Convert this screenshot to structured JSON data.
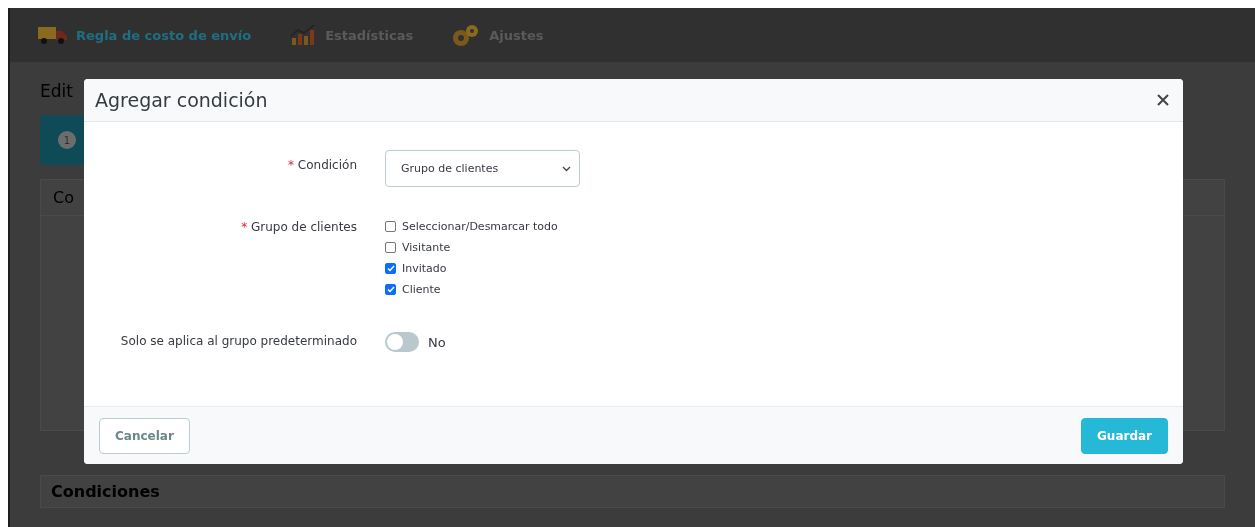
{
  "nav": {
    "tabs": [
      {
        "label": "Regla de costo de envío",
        "selected": true
      },
      {
        "label": "Estadísticas",
        "selected": false
      },
      {
        "label": "Ajustes",
        "selected": false
      }
    ]
  },
  "page": {
    "title": "Edit",
    "step": "1",
    "card_title": "Co",
    "section_title": "Condiciones"
  },
  "modal": {
    "title": "Agregar condición",
    "condition": {
      "label": "Condición",
      "required_mark": "*",
      "value": "Grupo de clientes"
    },
    "groups": {
      "label": "Grupo de clientes",
      "required_mark": "*",
      "options": [
        {
          "label": "Seleccionar/Desmarcar todo",
          "checked": false
        },
        {
          "label": "Visitante",
          "checked": false
        },
        {
          "label": "Invitado",
          "checked": true
        },
        {
          "label": "Cliente",
          "checked": true
        }
      ]
    },
    "default_only": {
      "label": "Solo se aplica al grupo predeterminado",
      "on": false,
      "state_text": "No"
    },
    "cancel": "Cancelar",
    "save": "Guardar"
  }
}
